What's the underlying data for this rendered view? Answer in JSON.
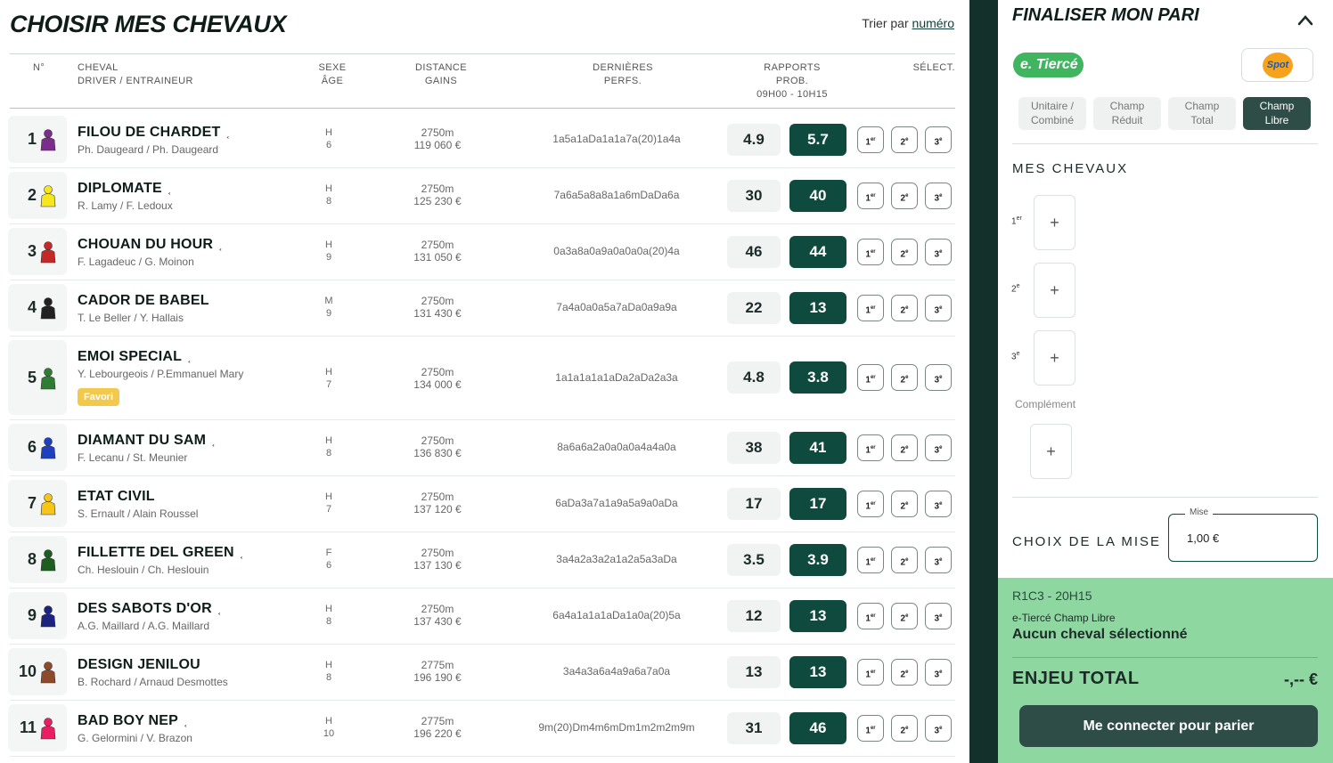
{
  "page_title": "CHOISIR MES CHEVAUX",
  "sort": {
    "prefix": "Trier par",
    "link": "numéro"
  },
  "headers": {
    "num": "N°",
    "cheval": "CHEVAL",
    "driver": "DRIVER / ENTRAINEUR",
    "sexe": "SEXE",
    "age": "ÂGE",
    "distance": "DISTANCE",
    "gains": "GAINS",
    "perfs1": "DERNIÈRES",
    "perfs2": "PERFS.",
    "rapports1": "RAPPORTS",
    "rapports2": "PROB.",
    "rapports3": "09H00 - 10H15",
    "select": "SÉLECT."
  },
  "pos_labels": {
    "p1": "1",
    "p1s": "er",
    "p2": "2",
    "p2s": "e",
    "p3": "3",
    "p3s": "e"
  },
  "silk_colors": [
    "#7b2d8e",
    "#f5e61e",
    "#c62828",
    "#222222",
    "#2e7d32",
    "#1e3fbf",
    "#f5c518",
    "#1b5e20",
    "#1a237e",
    "#8d4b2a",
    "#e91e63"
  ],
  "horses": [
    {
      "num": "1",
      "name": "FILOU DE CHARDET",
      "driver": "Ph. Daugeard / Ph. Daugeard",
      "sex": "H",
      "age": "6",
      "dist": "2750m",
      "gains": "119 060 €",
      "perfs": "1a5a1aDa1a1a7a(20)1a4a",
      "odd1": "4.9",
      "odd2": "5.7",
      "shoe": true
    },
    {
      "num": "2",
      "name": "DIPLOMATE",
      "driver": "R. Lamy / F. Ledoux",
      "sex": "H",
      "age": "8",
      "dist": "2750m",
      "gains": "125 230 €",
      "perfs": "7a6a5a8a8a1a6mDaDa6a",
      "odd1": "30",
      "odd2": "40",
      "shoe": true
    },
    {
      "num": "3",
      "name": "CHOUAN DU HOUR",
      "driver": "F. Lagadeuc / G. Moinon",
      "sex": "H",
      "age": "9",
      "dist": "2750m",
      "gains": "131 050 €",
      "perfs": "0a3a8a0a9a0a0a0a(20)4a",
      "odd1": "46",
      "odd2": "44",
      "shoe": true
    },
    {
      "num": "4",
      "name": "CADOR DE BABEL",
      "driver": "T. Le Beller / Y. Hallais",
      "sex": "M",
      "age": "9",
      "dist": "2750m",
      "gains": "131 430 €",
      "perfs": "7a4a0a0a5a7aDa0a9a9a",
      "odd1": "22",
      "odd2": "13",
      "shoe": false
    },
    {
      "num": "5",
      "name": "EMOI SPECIAL",
      "driver": "Y. Lebourgeois / P.Emmanuel Mary",
      "sex": "H",
      "age": "7",
      "dist": "2750m",
      "gains": "134 000 €",
      "perfs": "1a1a1a1a1aDa2aDa2a3a",
      "odd1": "4.8",
      "odd2": "3.8",
      "shoe": true,
      "favori": "Favori"
    },
    {
      "num": "6",
      "name": "DIAMANT DU SAM",
      "driver": "F. Lecanu / St. Meunier",
      "sex": "H",
      "age": "8",
      "dist": "2750m",
      "gains": "136 830 €",
      "perfs": "8a6a6a2a0a0a0a4a4a0a",
      "odd1": "38",
      "odd2": "41",
      "shoe": true
    },
    {
      "num": "7",
      "name": "ETAT CIVIL",
      "driver": "S. Ernault / Alain Roussel",
      "sex": "H",
      "age": "7",
      "dist": "2750m",
      "gains": "137 120 €",
      "perfs": "6aDa3a7a1a9a5a9a0aDa",
      "odd1": "17",
      "odd2": "17",
      "shoe": false
    },
    {
      "num": "8",
      "name": "FILLETTE DEL GREEN",
      "driver": "Ch. Heslouin / Ch. Heslouin",
      "sex": "F",
      "age": "6",
      "dist": "2750m",
      "gains": "137 130 €",
      "perfs": "3a4a2a3a2a1a2a5a3aDa",
      "odd1": "3.5",
      "odd2": "3.9",
      "shoe": true
    },
    {
      "num": "9",
      "name": "DES SABOTS D'OR",
      "driver": "A.G. Maillard / A.G. Maillard",
      "sex": "H",
      "age": "8",
      "dist": "2750m",
      "gains": "137 430 €",
      "perfs": "6a4a1a1a1aDa1a0a(20)5a",
      "odd1": "12",
      "odd2": "13",
      "shoe": true
    },
    {
      "num": "10",
      "name": "DESIGN JENILOU",
      "driver": "B. Rochard / Arnaud Desmottes",
      "sex": "H",
      "age": "8",
      "dist": "2775m",
      "gains": "196 190 €",
      "perfs": "3a4a3a6a4a9a6a7a0a",
      "odd1": "13",
      "odd2": "13",
      "shoe": false
    },
    {
      "num": "11",
      "name": "BAD BOY NEP",
      "driver": "G. Gelormini / V. Brazon",
      "sex": "H",
      "age": "10",
      "dist": "2775m",
      "gains": "196 220 €",
      "perfs": "9m(20)Dm4m6mDm1m2m2m9m",
      "odd1": "31",
      "odd2": "46",
      "shoe": true
    }
  ],
  "panel": {
    "title": "FINALISER MON PARI",
    "etierce": "e. Tiercé",
    "spot_label": "Spot",
    "bet_types": [
      {
        "l1": "Unitaire /",
        "l2": "Combiné"
      },
      {
        "l1": "Champ",
        "l2": "Réduit"
      },
      {
        "l1": "Champ",
        "l2": "Total"
      },
      {
        "l1": "Champ",
        "l2": "Libre"
      }
    ],
    "mes_chevaux": "MES CHEVAUX",
    "places": [
      {
        "n": "1",
        "s": "er"
      },
      {
        "n": "2",
        "s": "e"
      },
      {
        "n": "3",
        "s": "e"
      }
    ],
    "plus": "+",
    "complement": "Complément",
    "choix_mise": "CHOIX DE LA MISE",
    "mise_legend": "Mise",
    "mise_value": "1,00 €",
    "race": "R1C3 - 20H15",
    "bet_name": "e-Tiercé Champ Libre",
    "no_horse": "Aucun cheval sélectionné",
    "enjeu_label": "ENJEU TOTAL",
    "enjeu_value": "-,-- €",
    "cta": "Me connecter pour parier"
  }
}
